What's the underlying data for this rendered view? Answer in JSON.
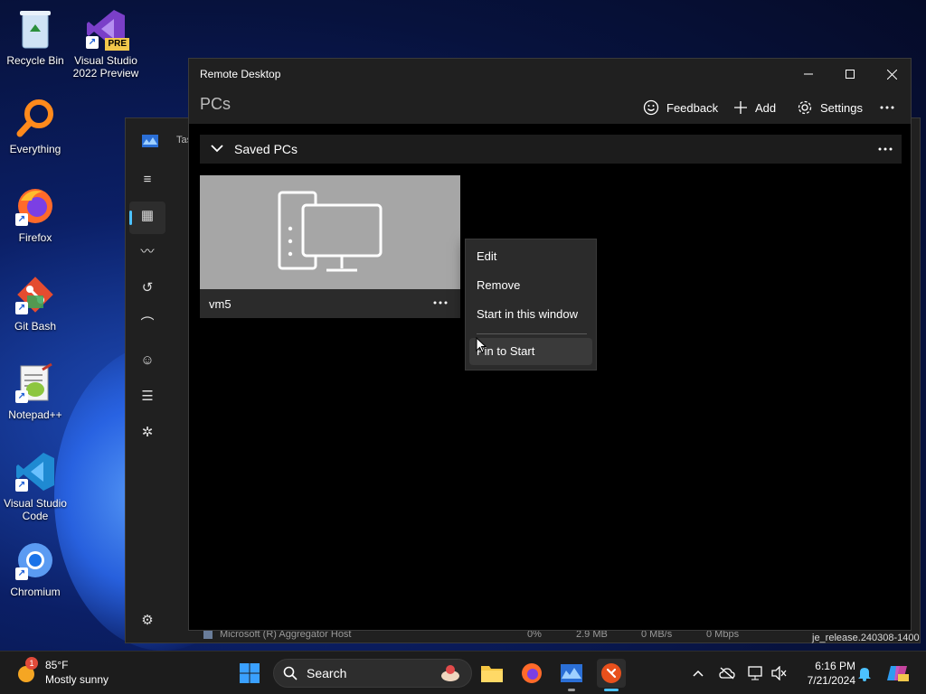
{
  "desktop": {
    "icons": [
      {
        "label": "Recycle Bin",
        "icon": "recycle-bin-icon"
      },
      {
        "label": "Visual Studio 2022 Preview",
        "icon": "visual-studio-preview-icon",
        "badge": "PRE"
      },
      {
        "label": "Everything",
        "icon": "everything-search-icon"
      },
      {
        "label": "Firefox",
        "icon": "firefox-icon"
      },
      {
        "label": "Git Bash",
        "icon": "git-bash-icon"
      },
      {
        "label": "Notepad++",
        "icon": "notepad-plus-plus-icon"
      },
      {
        "label": "Visual Studio Code",
        "icon": "vscode-icon"
      },
      {
        "label": "Chromium",
        "icon": "chromium-icon"
      }
    ],
    "build_text": "je_release.240308-1400"
  },
  "task_manager": {
    "title_partial": "Tas",
    "rail_icons": [
      "hamburger-icon",
      "processes-icon",
      "performance-icon",
      "app-history-icon",
      "startup-apps-icon",
      "users-icon",
      "details-icon",
      "services-icon",
      "settings-icon"
    ],
    "visible_row": {
      "name": "Microsoft (R) Aggregator Host",
      "cpu": "0%",
      "memory": "2.9 MB",
      "disk": "0 MB/s",
      "network": "0 Mbps"
    }
  },
  "remote_desktop": {
    "title": "Remote Desktop",
    "header_title": "PCs",
    "commands": {
      "feedback": "Feedback",
      "add": "Add",
      "settings": "Settings"
    },
    "group_label": "Saved PCs",
    "pc_tile": {
      "name": "vm5"
    },
    "context_menu": [
      "Edit",
      "Remove",
      "Start in this window",
      "Pin to Start"
    ],
    "hovered_item": "Pin to Start"
  },
  "taskbar": {
    "weather": {
      "temp": "85°F",
      "desc": "Mostly sunny",
      "badge": "1"
    },
    "search_placeholder": "Search",
    "clock": {
      "time": "6:16 PM",
      "date": "7/21/2024"
    }
  }
}
